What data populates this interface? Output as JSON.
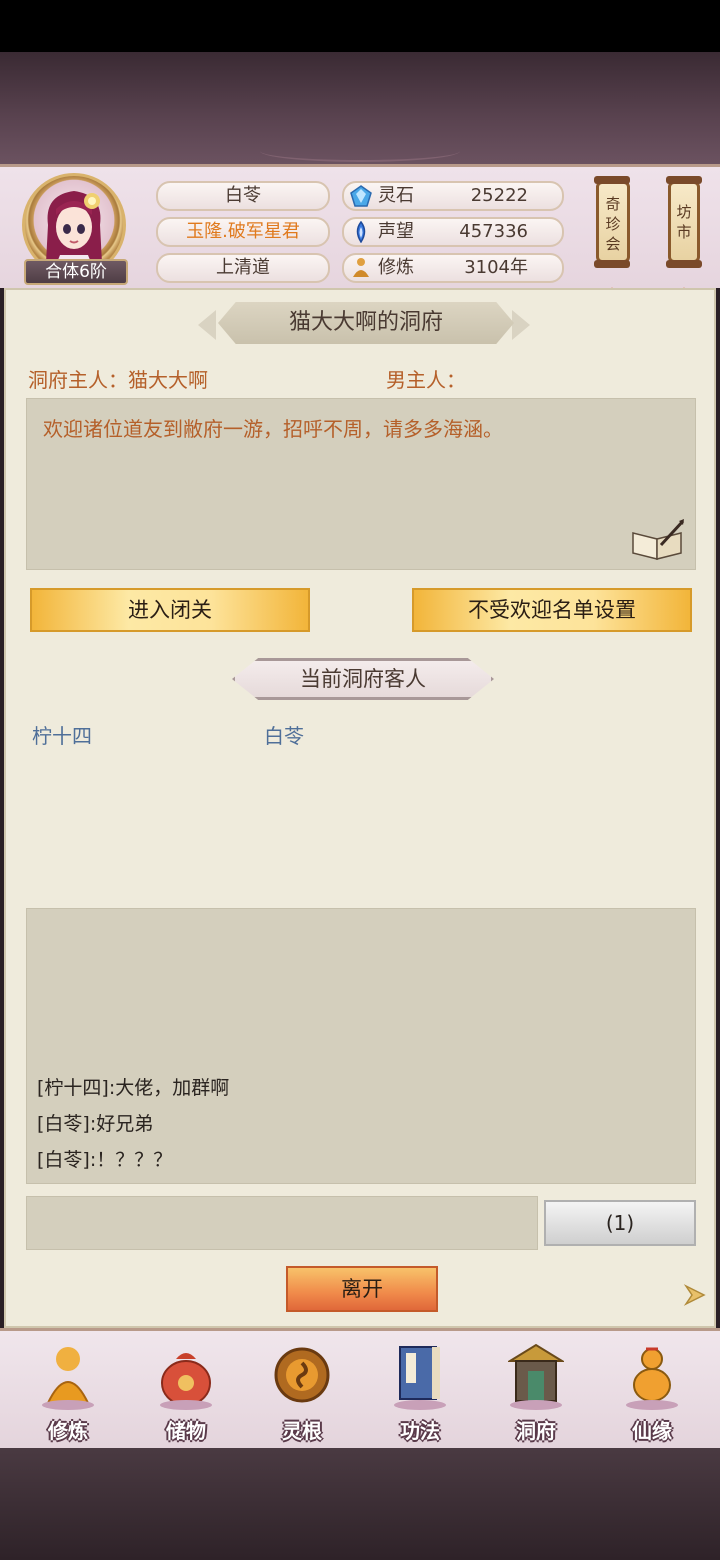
{
  "header": {
    "rank": "合体6阶",
    "name": "白苓",
    "title": "玉隆.破军星君",
    "sect": "上清道",
    "stats": [
      {
        "label": "灵石",
        "value": "25222",
        "icon": "spirit-stone-icon"
      },
      {
        "label": "声望",
        "value": "457336",
        "icon": "reputation-icon"
      },
      {
        "label": "修炼",
        "value": "3104年",
        "icon": "cultivation-icon"
      }
    ],
    "treasure_fair": "奇珍会",
    "market": "坊市"
  },
  "cave": {
    "title": "猫大大啊的洞府",
    "owner": "洞府主人：猫大大啊",
    "male_host": "男主人：",
    "welcome": "欢迎诸位道友到敝府一游，招呼不周，请多多海涵。",
    "enter_seclusion": "进入闭关",
    "blacklist_settings": "不受欢迎名单设置",
    "guests_title": "当前洞府客人",
    "guests": [
      "柠十四",
      "白苓"
    ]
  },
  "chat": {
    "messages": [
      "[柠十四]:大佬，加群啊",
      "[白苓]:好兄弟",
      "[白苓]:！？？？"
    ],
    "send_label": "(1)",
    "leave_label": "离开"
  },
  "nav": {
    "items": [
      "修炼",
      "储物",
      "灵根",
      "功法",
      "洞府",
      "仙缘"
    ]
  },
  "colors": {
    "accent_orange": "#e07a1e",
    "text_brown": "#b5602a",
    "guest_blue": "#4f6f99",
    "panel_bg": "#efebdc"
  }
}
